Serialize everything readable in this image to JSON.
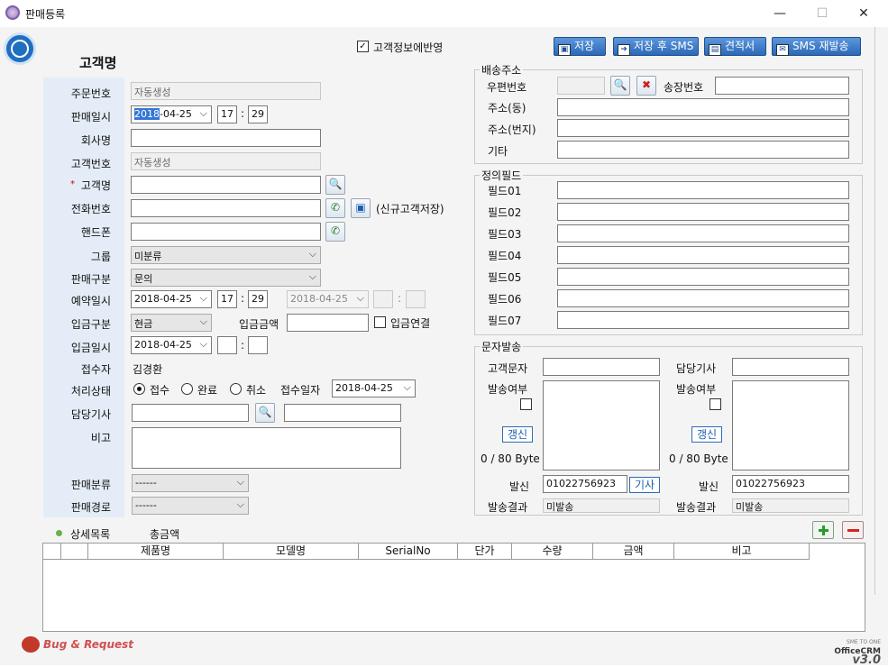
{
  "window": {
    "title": "판매등록",
    "minimize": "—",
    "maximize": "☐",
    "close": "✕"
  },
  "header": {
    "heading": "고객명",
    "reflect_checkbox": "고객정보에반영"
  },
  "toolbar": {
    "save": "저장",
    "save_sms": "저장 후 SMS",
    "quote": "견적서",
    "sms_resend": "SMS 재발송"
  },
  "form": {
    "order_no": {
      "label": "주문번호",
      "value": "자동생성"
    },
    "sale_date": {
      "label": "판매일시",
      "date": "2018-04-25",
      "date_hl": "2018",
      "date_rest": "-04-25",
      "hour": "17",
      "minute": "29"
    },
    "company": {
      "label": "회사명",
      "value": ""
    },
    "customer_no": {
      "label": "고객번호",
      "value": "자동생성"
    },
    "customer_name": {
      "label": "고객명",
      "required": "*",
      "value": ""
    },
    "phone": {
      "label": "전화번호",
      "value": "",
      "save_label": "(신규고객저장)"
    },
    "mobile": {
      "label": "핸드폰",
      "value": ""
    },
    "group": {
      "label": "그룹",
      "value": "미분류"
    },
    "sale_type": {
      "label": "판매구분",
      "value": "문의"
    },
    "reservation": {
      "label": "예약일시",
      "date": "2018-04-25",
      "hour": "17",
      "minute": "29",
      "date2": "2018-04-25"
    },
    "payment_type": {
      "label": "입금구분",
      "value": "현금",
      "amount_label": "입금금액",
      "link_label": "입금연결"
    },
    "payment_date": {
      "label": "입금일시",
      "date": "2018-04-25"
    },
    "receiver": {
      "label": "접수자",
      "value": "김경환"
    },
    "status": {
      "label": "처리상태",
      "options": [
        "접수",
        "완료",
        "취소"
      ],
      "selected": "접수",
      "date_label": "접수일자",
      "date": "2018-04-25"
    },
    "technician": {
      "label": "담당기사",
      "value": ""
    },
    "memo": {
      "label": "비고",
      "value": ""
    },
    "sale_class": {
      "label": "판매분류",
      "value": "------"
    },
    "sale_route": {
      "label": "판매경로",
      "value": "------"
    }
  },
  "shipping": {
    "title": "배송주소",
    "zip": "우편번호",
    "invoice": "송장번호",
    "addr1": "주소(동)",
    "addr2": "주소(번지)",
    "etc": "기타"
  },
  "custom_fields": {
    "title": "정의필드",
    "fields": [
      "필드01",
      "필드02",
      "필드03",
      "필드04",
      "필드05",
      "필드06",
      "필드07"
    ]
  },
  "sms": {
    "title": "문자발송",
    "customer": {
      "label": "고객문자",
      "send_label": "발송여부",
      "refresh": "갱신",
      "bytes": "0  / 80 Byte",
      "sender_label": "발신",
      "sender": "01022756923",
      "tech_btn": "기사",
      "result_label": "발송결과",
      "result": "미발송"
    },
    "tech": {
      "label": "담당기사",
      "send_label": "발송여부",
      "refresh": "갱신",
      "bytes": "0  / 80 Byte",
      "sender_label": "발신",
      "sender": "01022756923",
      "result_label": "발송결과",
      "result": "미발송"
    }
  },
  "detail": {
    "title": "상세목록",
    "total_label": "총금액",
    "columns": [
      "",
      "",
      "제품명",
      "모델명",
      "SerialNo",
      "단가",
      "수량",
      "금액",
      "비고"
    ]
  },
  "footer": {
    "bug": "Bug & Request",
    "brand_small": "SME TO ONE",
    "brand": "OfficeCRM",
    "version": "v3.0"
  },
  "colors": {
    "accent": "#2c69b8",
    "label_bg": "#e4edf7",
    "window_bg": "#f4f4f4"
  }
}
